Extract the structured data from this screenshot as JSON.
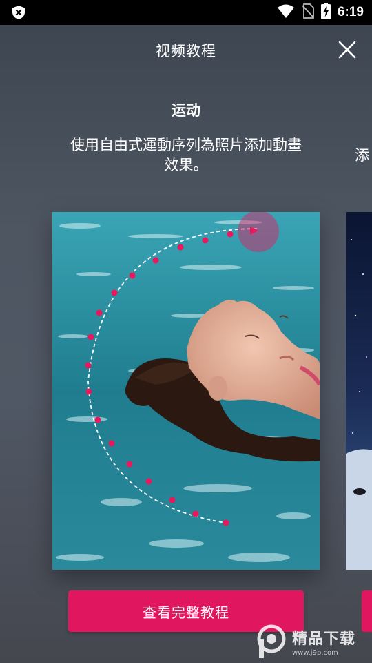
{
  "status_bar": {
    "time": "6:19",
    "icons": [
      "shield-x-icon",
      "wifi-icon",
      "no-sim-icon",
      "battery-charging-icon"
    ]
  },
  "header": {
    "title": "视频教程",
    "close_icon": "close-icon"
  },
  "card": {
    "title": "运动",
    "description_line1": "使用自由式運動序列為照片添加動畫",
    "description_line2": "效果。",
    "next_description_peek": "添",
    "photo_subject": "woman-floating-in-pool-with-motion-path",
    "cta_label": "查看完整教程"
  },
  "watermark": {
    "main": "精品下载",
    "sub": "www.j9p.com"
  },
  "colors": {
    "accent": "#e0175e",
    "motion_dot": "#e8185e",
    "water": "#2a8a9a"
  }
}
